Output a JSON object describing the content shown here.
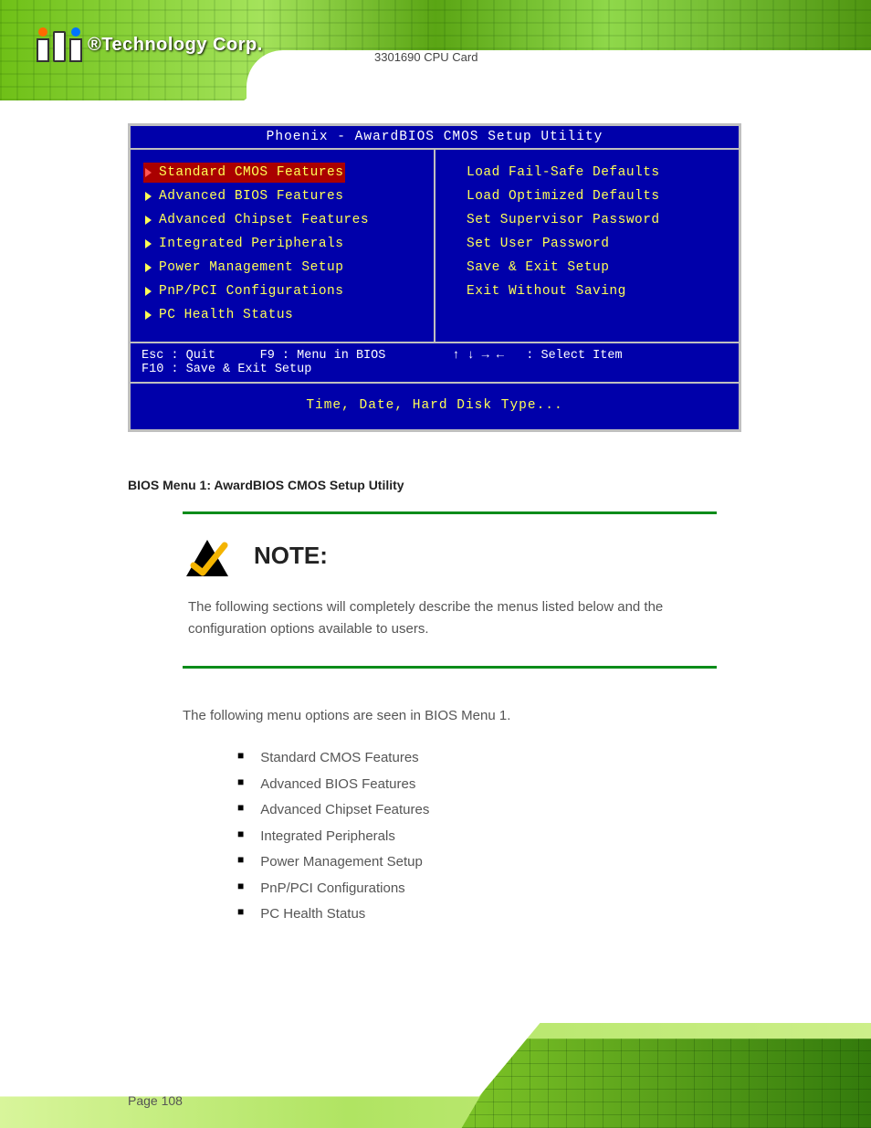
{
  "brand": {
    "name_reg": "®",
    "name": "Technology Corp."
  },
  "doc_title": "3301690 CPU Card",
  "bios": {
    "title": "Phoenix - AwardBIOS CMOS Setup Utility",
    "left": [
      "Standard CMOS Features",
      "Advanced BIOS Features",
      "Advanced Chipset Features",
      "Integrated Peripherals",
      "Power Management Setup",
      "PnP/PCI Configurations",
      "PC Health Status"
    ],
    "right": [
      "Load Fail-Safe Defaults",
      "Load Optimized Defaults",
      "Set Supervisor Password",
      "Set User Password",
      "Save & Exit Setup",
      "Exit Without Saving"
    ],
    "help_l1": "Esc : Quit      F9 : Menu in BIOS         ↑ ↓ → ←   : Select Item",
    "help_l2": "F10 : Save & Exit Setup",
    "hint": "Time, Date, Hard Disk Type..."
  },
  "caption": "BIOS Menu 1: AwardBIOS CMOS Setup Utility",
  "note": {
    "heading": "NOTE:",
    "body_pre": "The following sections will completely describe the menus listed below and the configuration options available to users.",
    "body_b1": "",
    "body_b2": ""
  },
  "para": "The following menu options are seen in BIOS Menu 1.",
  "para_link": "",
  "list": [
    "Standard CMOS Features",
    "Advanced BIOS Features",
    "Advanced Chipset Features",
    "Integrated Peripherals",
    "Power Management Setup",
    "PnP/PCI Configurations",
    "PC Health Status"
  ],
  "page_number": "Page 108"
}
